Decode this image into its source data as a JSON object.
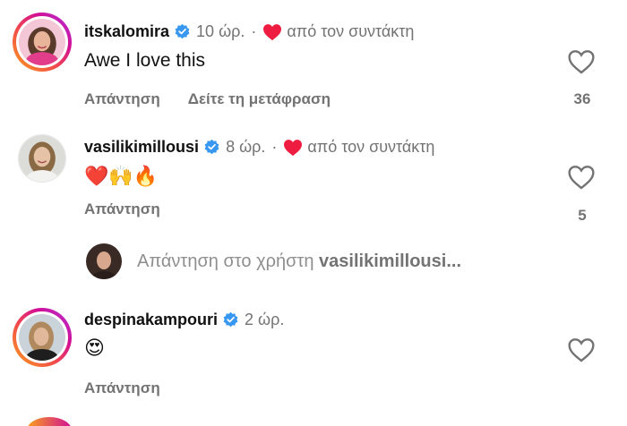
{
  "comments": [
    {
      "username": "itskalomira",
      "time": "10 ώρ.",
      "dot": "·",
      "by_author": "από τον συντάκτη",
      "text": "Awe I love this",
      "reply_label": "Απάντηση",
      "translate_label": "Δείτε τη μετάφραση",
      "likes": "36"
    },
    {
      "username": "vasilikimillousi",
      "time": "8 ώρ.",
      "dot": "·",
      "by_author": "από τον συντάκτη",
      "text": "❤️🙌🔥",
      "reply_label": "Απάντηση",
      "likes": "5"
    },
    {
      "username": "despinakampouri",
      "time": "2 ώρ.",
      "text": "😍",
      "reply_label": "Απάντηση"
    }
  ],
  "reply_prompt": {
    "prefix": "Απάντηση στο χρήστη",
    "username": "vasilikimillousi..."
  },
  "colors": {
    "verified": "#3897f0",
    "heart_red": "#ed1c40",
    "secondary_text": "#737373",
    "story_ring": [
      "#f9a11b",
      "#d10f96",
      "#b03ae0"
    ]
  },
  "icons": [
    "verified-badge-icon",
    "heart-filled-icon",
    "heart-outline-icon"
  ]
}
